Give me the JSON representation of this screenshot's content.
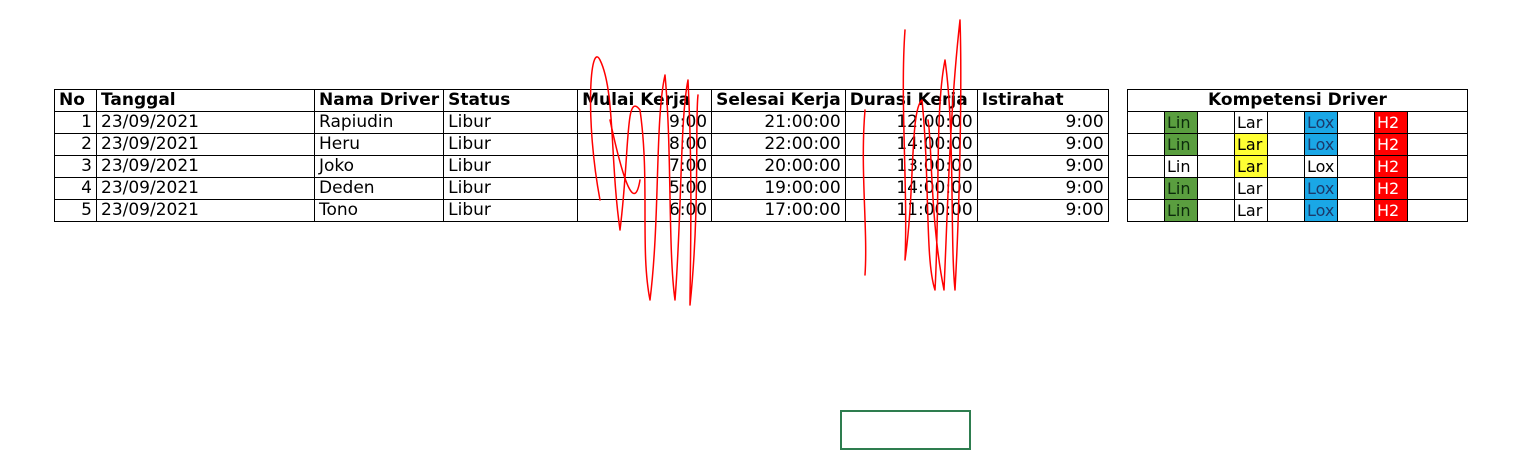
{
  "main_table": {
    "headers": [
      "No",
      "Tanggal",
      "Nama Driver",
      "Status",
      "Mulai Kerja",
      "Selesai Kerja",
      "Durasi Kerja",
      "Istirahat"
    ],
    "rows": [
      {
        "no": "1",
        "tanggal": "23/09/2021",
        "nama": "Rapiudin",
        "status": "Libur",
        "mulai": "9:00",
        "selesai": "21:00:00",
        "durasi": "12:00:00",
        "istirahat": "9:00"
      },
      {
        "no": "2",
        "tanggal": "23/09/2021",
        "nama": "Heru",
        "status": "Libur",
        "mulai": "8:00",
        "selesai": "22:00:00",
        "durasi": "14:00:00",
        "istirahat": "9:00"
      },
      {
        "no": "3",
        "tanggal": "23/09/2021",
        "nama": "Joko",
        "status": "Libur",
        "mulai": "7:00",
        "selesai": "20:00:00",
        "durasi": "13:00:00",
        "istirahat": "9:00"
      },
      {
        "no": "4",
        "tanggal": "23/09/2021",
        "nama": "Deden",
        "status": "Libur",
        "mulai": "5:00",
        "selesai": "19:00:00",
        "durasi": "14:00:00",
        "istirahat": "9:00"
      },
      {
        "no": "5",
        "tanggal": "23/09/2021",
        "nama": "Tono",
        "status": "Libur",
        "mulai": "6:00",
        "selesai": "17:00:00",
        "durasi": "11:00:00",
        "istirahat": "9:00"
      }
    ]
  },
  "kompetensi": {
    "title": "Kompetensi Driver",
    "colors": {
      "green": "#5a9e3f",
      "yellow": "#ffff33",
      "blue": "#1aa7e6",
      "red": "#ff0000",
      "none": "#ffffff"
    },
    "rows": [
      [
        {
          "label": "Lin",
          "color": "green"
        },
        {
          "label": "Lar",
          "color": "none"
        },
        {
          "label": "Lox",
          "color": "blue"
        },
        {
          "label": "H2",
          "color": "red"
        }
      ],
      [
        {
          "label": "Lin",
          "color": "green"
        },
        {
          "label": "Lar",
          "color": "yellow"
        },
        {
          "label": "Lox",
          "color": "blue"
        },
        {
          "label": "H2",
          "color": "red"
        }
      ],
      [
        {
          "label": "Lin",
          "color": "none"
        },
        {
          "label": "Lar",
          "color": "yellow"
        },
        {
          "label": "Lox",
          "color": "none"
        },
        {
          "label": "H2",
          "color": "red"
        }
      ],
      [
        {
          "label": "Lin",
          "color": "green"
        },
        {
          "label": "Lar",
          "color": "none"
        },
        {
          "label": "Lox",
          "color": "blue"
        },
        {
          "label": "H2",
          "color": "red"
        }
      ],
      [
        {
          "label": "Lin",
          "color": "green"
        },
        {
          "label": "Lar",
          "color": "none"
        },
        {
          "label": "Lox",
          "color": "blue"
        },
        {
          "label": "H2",
          "color": "red"
        }
      ]
    ]
  },
  "annotation": {
    "stroke_color": "#ff0000"
  }
}
